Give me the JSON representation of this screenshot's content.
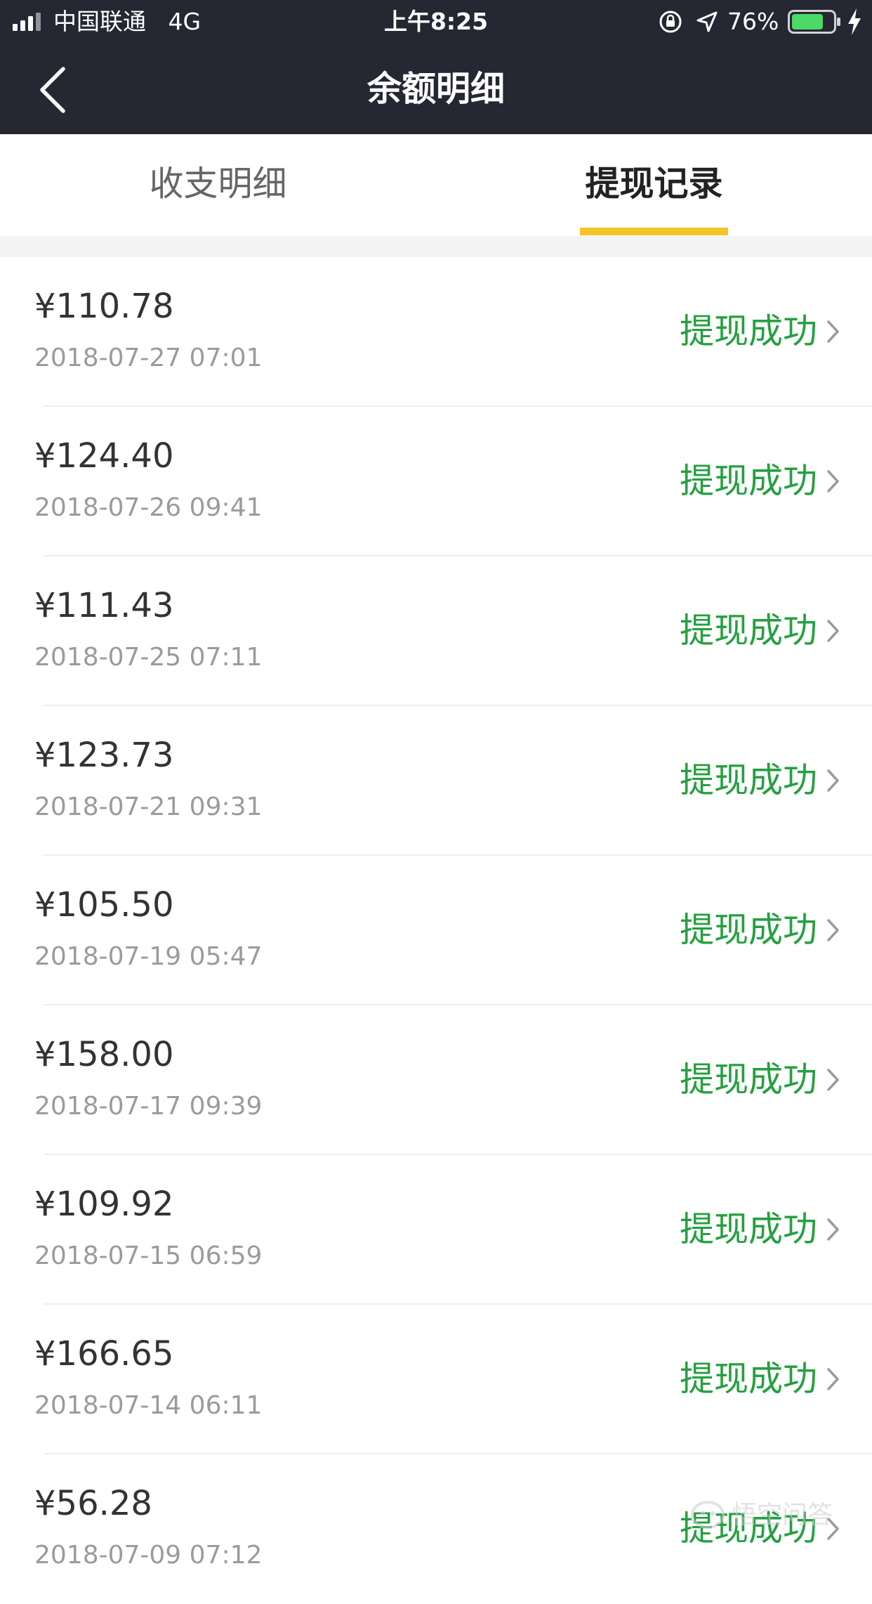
{
  "status_bar": {
    "carrier": "中国联通",
    "network": "4G",
    "time": "上午8:25",
    "battery": "76%",
    "battery_level": 0.76,
    "signal_icon": "signal-bars-icon",
    "lock_icon": "orientation-lock-icon",
    "location_icon": "location-arrow-icon",
    "charging_icon": "charging-bolt-icon"
  },
  "nav": {
    "title": "余额明细",
    "back_icon": "chevron-left-icon"
  },
  "tabs": [
    {
      "label": "收支明细",
      "active": false
    },
    {
      "label": "提现记录",
      "active": true
    }
  ],
  "colors": {
    "header_bg": "#252732",
    "accent_yellow": "#F5C42B",
    "success_green": "#25A040",
    "amount_text": "#333333",
    "time_text": "#9B9B9B"
  },
  "records": [
    {
      "amount": "¥110.78",
      "time": "2018-07-27 07:01",
      "status": "提现成功"
    },
    {
      "amount": "¥124.40",
      "time": "2018-07-26 09:41",
      "status": "提现成功"
    },
    {
      "amount": "¥111.43",
      "time": "2018-07-25 07:11",
      "status": "提现成功"
    },
    {
      "amount": "¥123.73",
      "time": "2018-07-21 09:31",
      "status": "提现成功"
    },
    {
      "amount": "¥105.50",
      "time": "2018-07-19 05:47",
      "status": "提现成功"
    },
    {
      "amount": "¥158.00",
      "time": "2018-07-17 09:39",
      "status": "提现成功"
    },
    {
      "amount": "¥109.92",
      "time": "2018-07-15 06:59",
      "status": "提现成功"
    },
    {
      "amount": "¥166.65",
      "time": "2018-07-14 06:11",
      "status": "提现成功"
    },
    {
      "amount": "¥56.28",
      "time": "2018-07-09 07:12",
      "status": "提现成功"
    }
  ],
  "watermark": {
    "text": "悟空问答",
    "icon": "wukong-logo-icon"
  }
}
